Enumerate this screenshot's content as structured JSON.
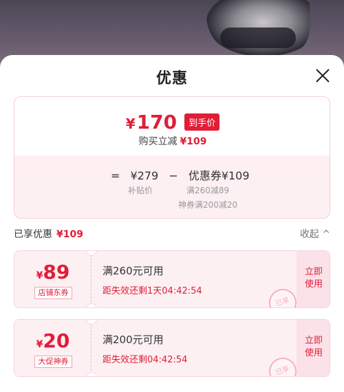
{
  "sheet": {
    "title": "优惠"
  },
  "summary": {
    "final_yen": "¥",
    "final_price": "170",
    "price_tag": "到手价",
    "save_text": "购买立减",
    "save_amount": "¥109",
    "formula": {
      "equals": "=",
      "original": "¥279",
      "minus": "−",
      "coupon_label": "优惠券¥109"
    },
    "original_note": "补贴价",
    "coupon_note_1": "满260减89",
    "coupon_note_2": "神券满200减20"
  },
  "enjoyed": {
    "label": "已享优惠",
    "amount": "¥109",
    "collapse": "收起 ^"
  },
  "coupons": [
    {
      "yen": "¥",
      "value": "89",
      "label": "店铺东券",
      "condition": "满260元可用",
      "timer": "距失效还剩1天04:42:54",
      "use": "立即\n使用",
      "stamp": "已享"
    },
    {
      "yen": "¥",
      "value": "20",
      "label": "大促神券",
      "condition": "满200元可用",
      "timer": "距失效还剩04:42:54",
      "use": "立即\n使用",
      "stamp": "已享"
    }
  ],
  "colors": {
    "accent": "#e11d37",
    "coupon_bg": "#fdf0f3"
  },
  "icons": {
    "close": "close-icon"
  }
}
